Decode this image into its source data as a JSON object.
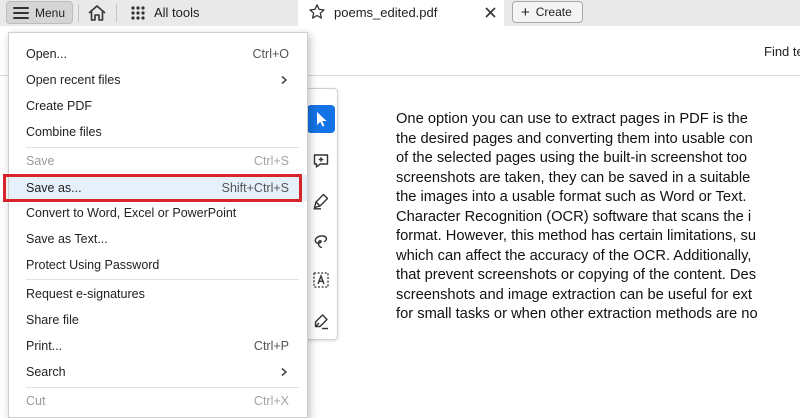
{
  "tabbar": {
    "menu_label": "Menu",
    "all_tools_label": "All tools",
    "doc_tab_title": "poems_edited.pdf",
    "create_label": "Create"
  },
  "subbar": {
    "find_text": "Find te"
  },
  "menu": {
    "items": [
      {
        "label": "Open...",
        "shortcut": "Ctrl+O"
      },
      {
        "label": "Open recent files",
        "shortcut": ""
      },
      {
        "label": "Create PDF",
        "shortcut": ""
      },
      {
        "label": "Combine files",
        "shortcut": ""
      },
      {
        "label": "Save",
        "shortcut": "Ctrl+S"
      },
      {
        "label": "Save as...",
        "shortcut": "Shift+Ctrl+S"
      },
      {
        "label": "Convert to Word, Excel or PowerPoint",
        "shortcut": ""
      },
      {
        "label": "Save as Text...",
        "shortcut": ""
      },
      {
        "label": "Protect Using Password",
        "shortcut": ""
      },
      {
        "label": "Request e-signatures",
        "shortcut": ""
      },
      {
        "label": "Share file",
        "shortcut": ""
      },
      {
        "label": "Print...",
        "shortcut": "Ctrl+P"
      },
      {
        "label": "Search",
        "shortcut": ""
      },
      {
        "label": "Cut",
        "shortcut": "Ctrl+X"
      }
    ]
  },
  "document": {
    "lines": [
      "One option you can use to extract pages in PDF is the",
      "the desired pages and converting them into usable con",
      "of the selected pages using the built-in screenshot too",
      "screenshots are taken, they can be saved in a suitable",
      "the images into a usable format such as Word or Text.",
      "Character Recognition (OCR) software that scans the i",
      "format. However, this method has certain limitations, su",
      "which can affect the accuracy of the OCR. Additionally,",
      "that prevent screenshots or copying of the content. Des",
      "screenshots and image extraction can be useful for ext",
      "for small tasks or when other extraction methods are no"
    ]
  },
  "colors": {
    "accent": "#1473e6",
    "highlight_border": "#d8232a",
    "highlight_fill": "#e6f0fb"
  },
  "icons": [
    "menu-icon",
    "home-icon",
    "apps-grid-icon",
    "star-icon",
    "close-icon",
    "plus-icon",
    "select-arrow-icon",
    "add-comment-icon",
    "highlighter-icon",
    "draw-lasso-icon",
    "text-select-icon",
    "sign-pen-icon",
    "chevron-right-icon"
  ]
}
